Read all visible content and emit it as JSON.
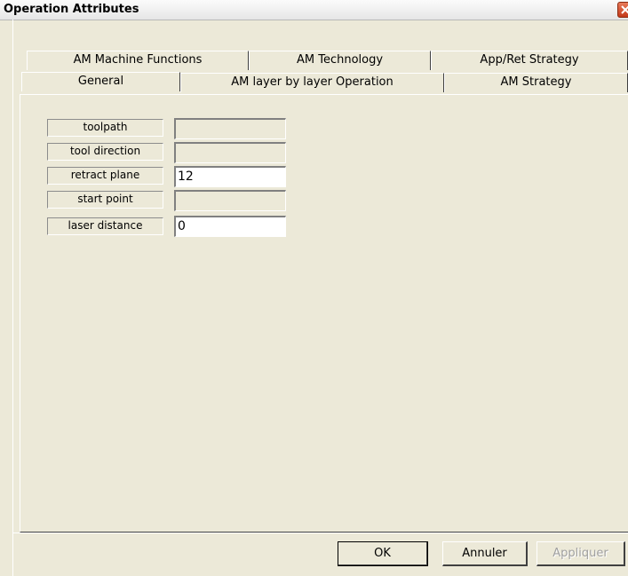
{
  "window": {
    "title": "Operation Attributes",
    "close_icon": "close-icon"
  },
  "tabs_back_row": [
    {
      "label": "AM Machine Functions"
    },
    {
      "label": "AM Technology"
    },
    {
      "label": "App/Ret Strategy"
    }
  ],
  "tabs_front_row": [
    {
      "label": "General",
      "active": true
    },
    {
      "label": "AM layer by layer Operation",
      "active": false
    },
    {
      "label": "AM Strategy",
      "active": false
    }
  ],
  "fields": [
    {
      "label": "toolpath",
      "value": "",
      "enabled": false
    },
    {
      "label": "tool direction",
      "value": "",
      "enabled": false
    },
    {
      "label": "retract plane",
      "value": "12",
      "enabled": true
    },
    {
      "label": "start point",
      "value": "",
      "enabled": false
    },
    {
      "label": "laser distance",
      "value": "0",
      "enabled": true
    }
  ],
  "buttons": {
    "ok": "OK",
    "cancel": "Annuler",
    "apply": "Appliquer"
  },
  "colors": {
    "dialog_bg": "#ece9d8",
    "close_button": "#c3391a"
  }
}
